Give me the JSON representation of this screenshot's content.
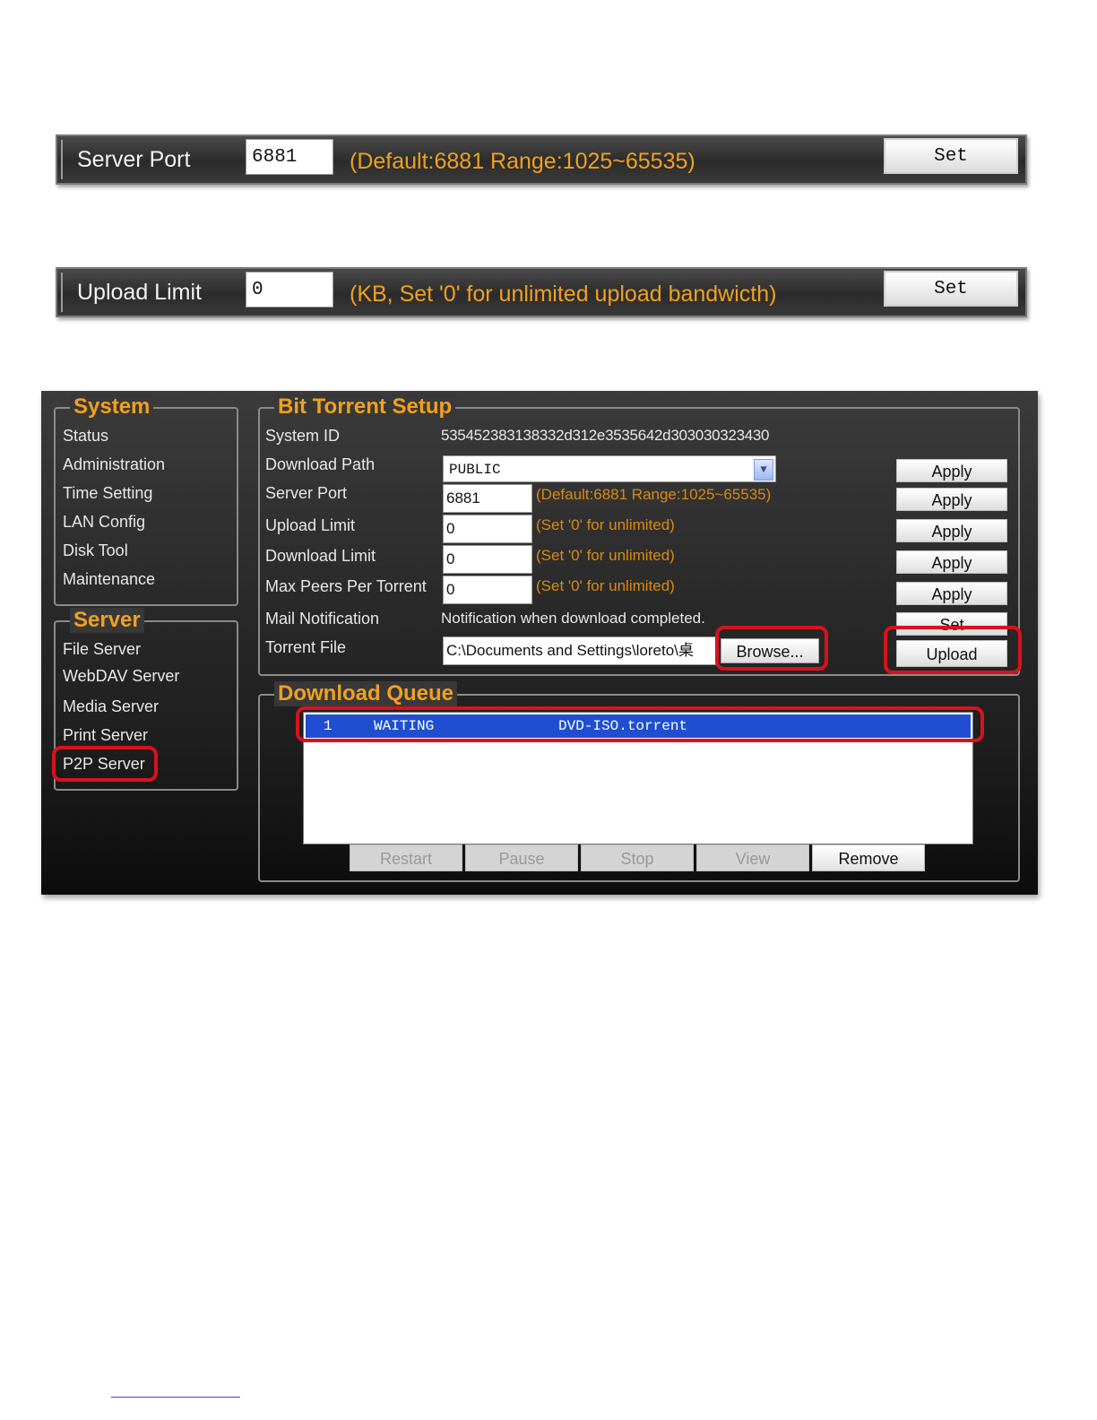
{
  "strip_port": {
    "label": "Server Port",
    "value": "6881",
    "hint": "(Default:6881  Range:1025~65535)",
    "button": "Set"
  },
  "strip_upload": {
    "label": "Upload Limit",
    "value": "0",
    "hint": "(KB, Set '0' for unlimited upload bandwicth)",
    "button": "Set"
  },
  "sidebar": {
    "system_title": "System",
    "system_items": [
      "Status",
      "Administration",
      "Time Setting",
      "LAN Config",
      "Disk Tool",
      "Maintenance"
    ],
    "server_title": "Server",
    "server_items": [
      "File Server",
      "WebDAV Server",
      "Media Server",
      "Print Server",
      "P2P Server"
    ]
  },
  "setup": {
    "title": "Bit Torrent Setup",
    "system_id_label": "System ID",
    "system_id": "535452383138332d312e3535642d303030323430",
    "download_path_label": "Download Path",
    "download_path": "PUBLIC",
    "server_port_label": "Server Port",
    "server_port": "6881",
    "server_port_hint": "(Default:6881 Range:1025~65535)",
    "upload_limit_label": "Upload Limit",
    "upload_limit": "0",
    "download_limit_label": "Download Limit",
    "download_limit": "0",
    "max_peers_label": "Max Peers Per Torrent",
    "max_peers": "0",
    "unlimited_hint": "(Set '0' for unlimited)",
    "mail_label": "Mail Notification",
    "mail_text": "Notification when download completed.",
    "torrent_label": "Torrent File",
    "torrent_path": "C:\\Documents and Settings\\loreto\\桌",
    "browse": "Browse...",
    "apply": "Apply",
    "set": "Set",
    "upload": "Upload"
  },
  "queue": {
    "title": "Download Queue",
    "rows": [
      {
        "num": "1",
        "status": "WAITING",
        "file": "DVD-ISO.torrent"
      }
    ],
    "buttons": [
      "Restart",
      "Pause",
      "Stop",
      "View",
      "Remove"
    ]
  },
  "colors": {
    "accent": "#f0a020",
    "highlight": "#d8121e",
    "selection": "#1f4fd0"
  }
}
